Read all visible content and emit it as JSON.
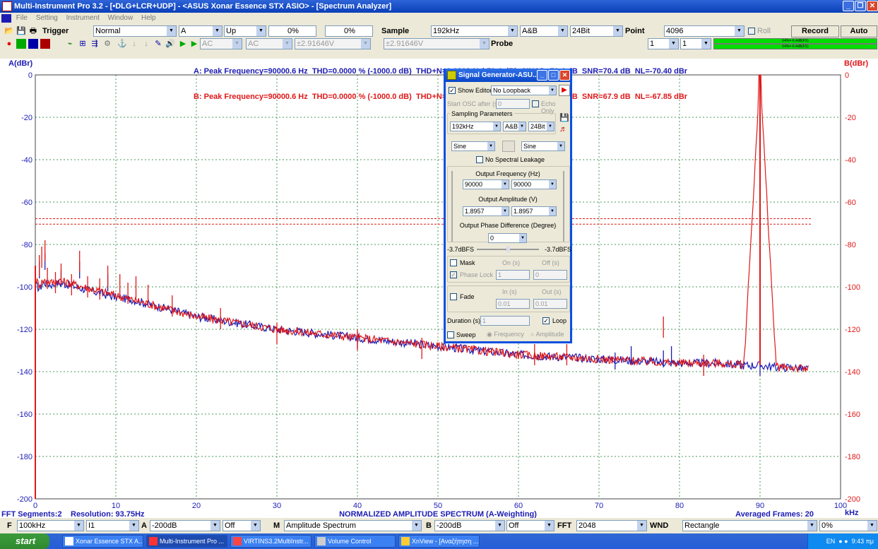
{
  "window": {
    "title": "Multi-Instrument Pro 3.2   - [•DLG+LCR+UDP]   - <ASUS Xonar Essence STX ASIO> - [Spectrum Analyzer]"
  },
  "menu": [
    "File",
    "Setting",
    "Instrument",
    "Window",
    "Help"
  ],
  "toolbar1": {
    "trigger_label": "Trigger",
    "trigger_mode": "Normal",
    "trigger_channel": "A",
    "trigger_edge": "Up",
    "pct1": "0%",
    "pct2": "0%",
    "sample_label": "Sample",
    "sample_rate": "192kHz",
    "channels": "A&B",
    "bits": "24Bit",
    "point_label": "Point",
    "points": "4096",
    "roll_label": "Roll",
    "record": "Record",
    "auto": "Auto"
  },
  "toolbar2": {
    "coupling_a": "AC",
    "coupling_b": "AC",
    "range_a": "±2.91646V",
    "range_b": "±2.91646V",
    "probe_label": "Probe",
    "probe_a": "1",
    "probe_b": "1",
    "meter_a": "64%=-6.4dB(FS)",
    "meter_b": "64%=-6.4dB(FS)"
  },
  "measurements": {
    "a": "A: Peak Frequency=90000.6 Hz  THD=0.0000 % (-1000.0 dB)  THD+N=0.0302 % (-70.4 dB)  SINAD=70.4 dB  SNR=70.4 dB  NL=-70.40 dBr",
    "b": "B: Peak Frequency=90000.6 Hz  THD=0.0000 % (-1000.0 dB)  THD+N=0.0405 % (-67.9 dB)  SINAD=67.9 dB  SNR=67.9 dB  NL=-67.85 dBr"
  },
  "chart_data": {
    "type": "line",
    "title": "NORMALIZED AMPLITUDE SPECTRUM (A-Weighting)",
    "ylabel_left": "A(dBr)",
    "ylabel_right": "B(dBr)",
    "xunit": "kHz",
    "xlim": [
      0,
      100
    ],
    "ylim": [
      -200,
      0
    ],
    "xticks": [
      0,
      10,
      20,
      30,
      40,
      50,
      60,
      70,
      80,
      90,
      100
    ],
    "yticks": [
      0,
      -20,
      -40,
      -60,
      -80,
      -100,
      -120,
      -140,
      -160,
      -180,
      -200
    ],
    "noise_level_a": -70.4,
    "noise_level_b": -67.85,
    "colors": {
      "a": "#1c1cb4",
      "b": "#e01818",
      "grid": "#4a9a5a",
      "axis": "#1c1cb4"
    },
    "series": [
      {
        "name": "A",
        "color": "#1c1cb4",
        "x": [
          0.1,
          0.5,
          1,
          2,
          3,
          4,
          5,
          6,
          8,
          10,
          12,
          15,
          20,
          25,
          30,
          35,
          40,
          45,
          50,
          55,
          60,
          65,
          70,
          75,
          80,
          85,
          88,
          90,
          92,
          94,
          96
        ],
        "y": [
          -99,
          -101,
          -98,
          -99,
          -98,
          -99,
          -100,
          -101,
          -103,
          -105,
          -106,
          -109,
          -114,
          -117,
          -120,
          -122,
          -124,
          -126,
          -128,
          -130,
          -132,
          -133,
          -134,
          -135,
          -136,
          -136,
          -137,
          -137,
          -138,
          -138,
          -139
        ]
      },
      {
        "name": "B",
        "color": "#e01818",
        "x": [
          0.1,
          0.5,
          1,
          2,
          3,
          4,
          5,
          6,
          8,
          10,
          12,
          15,
          20,
          25,
          30,
          35,
          40,
          45,
          50,
          55,
          60,
          65,
          70,
          75,
          80,
          85,
          88,
          90,
          92,
          94,
          96
        ],
        "y": [
          -97,
          -99,
          -97,
          -98,
          -97,
          -98,
          -99,
          -100,
          -102,
          -104,
          -106,
          -109,
          -114,
          -117,
          -120,
          -122,
          -124,
          -126,
          -128,
          -130,
          -132,
          -133,
          -134,
          -135,
          -136,
          -136,
          -137,
          0,
          -138,
          -138,
          -139
        ]
      }
    ],
    "spurs_b": [
      [
        0.5,
        -85
      ],
      [
        0.8,
        -81
      ],
      [
        1.2,
        -78
      ],
      [
        1.5,
        -91
      ],
      [
        2.5,
        -93
      ],
      [
        3.2,
        -89
      ],
      [
        4.5,
        -94
      ],
      [
        5.5,
        -83
      ],
      [
        6.5,
        -95
      ],
      [
        8,
        -96
      ],
      [
        9,
        -90
      ],
      [
        10.5,
        -94
      ],
      [
        11.5,
        -98
      ],
      [
        12.5,
        -95
      ],
      [
        14,
        -99
      ],
      [
        17,
        -104
      ],
      [
        23,
        -110
      ],
      [
        30,
        -117
      ],
      [
        40,
        -120
      ],
      [
        48,
        -124
      ],
      [
        62,
        -127
      ],
      [
        66,
        -127
      ],
      [
        78,
        -114
      ],
      [
        83,
        -132
      ]
    ],
    "spurs_a": [
      [
        0.5,
        -88
      ],
      [
        1.2,
        -84
      ],
      [
        3.2,
        -92
      ],
      [
        5.5,
        -88
      ],
      [
        9,
        -94
      ],
      [
        40,
        -121
      ],
      [
        72,
        -131
      ],
      [
        74,
        -128
      ],
      [
        78,
        -130
      ],
      [
        79,
        -128
      ],
      [
        90,
        -134
      ]
    ]
  },
  "footer": {
    "segments": "FFT Segments:2",
    "resolution": "Resolution: 93.75Hz",
    "averaged": "Averaged Frames: 20"
  },
  "generator": {
    "title": "Signal Generator-ASU...",
    "show_editor": "Show Editor",
    "loopback": "No Loopback",
    "start_osc": "Start OSC after (s)",
    "start_osc_val": "0",
    "echo_only": "Echo Only",
    "sampling_params": "Sampling Parameters",
    "rate": "192kHz",
    "ch": "A&B",
    "bits": "24Bit",
    "wave_a": "Sine",
    "wave_b": "Sine",
    "no_leak": "No Spectral Leakage",
    "freq_label": "Output Frequency (Hz)",
    "freq_a": "90000",
    "freq_b": "90000",
    "amp_label": "Output Amplitude (V)",
    "amp_a": "1.8957",
    "amp_b": "1.8957",
    "phase_label": "Output Phase Difference (Degree)",
    "phase": "0",
    "level_a": "-3.7dBFS",
    "level_b": "-3.7dBFS",
    "mask": "Mask",
    "on_s": "On (s)",
    "off_s": "Off (s)",
    "phase_lock": "Phase Lock",
    "on_val": "1",
    "off_val": "0",
    "fade": "Fade",
    "in_s": "In (s)",
    "out_s": "Out (s)",
    "in_val": "0.01",
    "out_val": "0.01",
    "duration": "Duration (s)",
    "duration_val": "1",
    "loop": "Loop",
    "sweep": "Sweep",
    "frequency": "Frequency",
    "amplitude": "Amplitude"
  },
  "bottombar": {
    "f_label": "F",
    "f_val": "100kHz",
    "f2": "I1",
    "a_label": "A",
    "a_range": "-200dB",
    "a_off": "Off",
    "m_label": "M",
    "m_val": "Amplitude Spectrum",
    "b_label": "B",
    "b_range": "-200dB",
    "b_off": "Off",
    "fft_label": "FFT",
    "fft_val": "2048",
    "wnd_label": "WND",
    "wnd_val": "Rectangle",
    "pct": "0%"
  },
  "taskbar": {
    "start": "start",
    "tasks": [
      "Xonar Essence STX A...",
      "Multi-Instrument Pro ...",
      "VIRTINS3.2MultiInstr...",
      "Volume Control",
      "XnView - [Αναζήτηση ..."
    ],
    "lang": "EN",
    "clock": "9:43 πμ"
  }
}
